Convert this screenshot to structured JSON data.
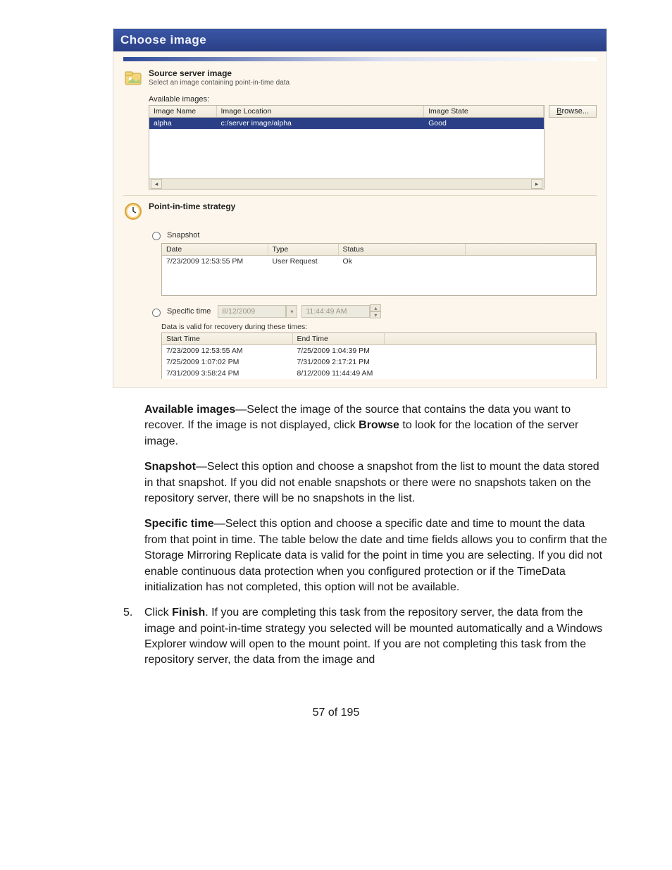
{
  "dialog": {
    "title": "Choose image",
    "source_section": {
      "title": "Source server image",
      "subtitle": "Select an image containing point-in-time data"
    },
    "available_images_label": "Available images:",
    "browse_label": "Browse...",
    "images_table": {
      "headers": [
        "Image Name",
        "Image Location",
        "Image State"
      ],
      "rows": [
        {
          "name": "alpha",
          "location": "c:/server image/alpha",
          "state": "Good"
        }
      ]
    },
    "pit_section_title": "Point-in-time strategy",
    "snapshot_label": "Snapshot",
    "snapshot_table": {
      "headers": [
        "Date",
        "Type",
        "Status",
        ""
      ],
      "rows": [
        {
          "date": "7/23/2009 12:53:55 PM",
          "type": "User Request",
          "status": "Ok"
        }
      ]
    },
    "specific_time_label": "Specific time",
    "specific_date_value": "8/12/2009",
    "specific_time_value": "11:44:49 AM",
    "valid_times_label": "Data is valid for recovery during these times:",
    "times_table": {
      "headers": [
        "Start Time",
        "End Time",
        ""
      ],
      "rows": [
        {
          "start": "7/23/2009 12:53:55 AM",
          "end": "7/25/2009 1:04:39 PM"
        },
        {
          "start": "7/25/2009 1:07:02 PM",
          "end": "7/31/2009 2:17:21 PM"
        },
        {
          "start": "7/31/2009 3:58:24 PM",
          "end": "8/12/2009 11:44:49 AM"
        }
      ]
    }
  },
  "doc": {
    "p1_bold": "Available images",
    "p1_rest": "—Select the image of the source that contains the data you want to recover. If the image is not displayed, click ",
    "p1_bold2": "Browse",
    "p1_rest2": " to look for the location of the server image.",
    "p2_bold": "Snapshot",
    "p2_rest": "—Select this option and choose a snapshot from the list to mount the data stored in that snapshot. If you did not enable snapshots or there were no snapshots taken on the repository server, there will be no snapshots in the list.",
    "p3_bold": "Specific time",
    "p3_rest": "—Select this option and choose a specific date and time to mount the data from that point in time. The table below the date and time fields allows you to confirm that the Storage Mirroring Replicate data is valid for the point in time you are selecting. If you did not enable continuous data protection when you configured protection or if the TimeData initialization has not completed, this option will not be available.",
    "item5_num": "5.",
    "item5_pre": "Click ",
    "item5_bold": "Finish",
    "item5_rest": ". If you are completing this task from the repository server, the data from the image and point-in-time strategy you selected will be mounted automatically and a Windows Explorer window will open to the mount point. If you are not completing this task from the repository server, the data from the image and",
    "page_num": "57 of 195"
  }
}
